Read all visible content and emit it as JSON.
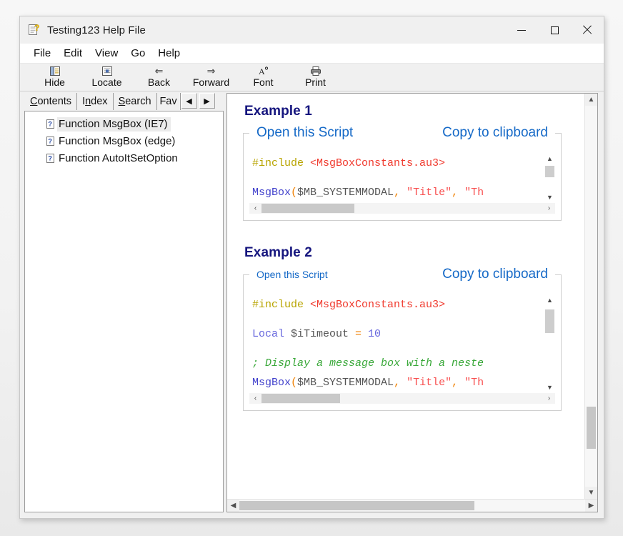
{
  "window": {
    "title": "Testing123 Help File",
    "icon": "help-document-icon",
    "controls": {
      "minimize": "minimize-icon",
      "maximize": "maximize-icon",
      "close": "close-icon"
    }
  },
  "menu": {
    "items": [
      "File",
      "Edit",
      "View",
      "Go",
      "Help"
    ]
  },
  "toolbar": {
    "buttons": [
      {
        "label": "Hide",
        "icon": "hide-pane-icon"
      },
      {
        "label": "Locate",
        "icon": "locate-topic-icon"
      },
      {
        "label": "Back",
        "icon": "back-arrow-icon"
      },
      {
        "label": "Forward",
        "icon": "forward-arrow-icon"
      },
      {
        "label": "Font",
        "icon": "font-icon"
      },
      {
        "label": "Print",
        "icon": "printer-icon"
      }
    ]
  },
  "left_pane": {
    "tabs": [
      {
        "label": "Contents",
        "accel": "C",
        "active": true
      },
      {
        "label": "Index",
        "accel": "n",
        "active": false
      },
      {
        "label": "Search",
        "accel": "S",
        "active": false
      },
      {
        "label": "Fav",
        "accel": "",
        "active": false,
        "clipped": true
      }
    ],
    "tab_nav": {
      "prev": "left-arrow-icon",
      "next": "right-arrow-icon"
    },
    "tree_items": [
      {
        "label": "Function MsgBox (IE7)",
        "icon": "help-topic-icon",
        "selected": true
      },
      {
        "label": "Function MsgBox (edge)",
        "icon": "help-topic-icon",
        "selected": false
      },
      {
        "label": "Function AutoItSetOption",
        "icon": "help-topic-icon",
        "selected": false
      }
    ]
  },
  "content": {
    "examples": [
      {
        "title": "Example 1",
        "open_link": "Open this Script",
        "copy_link": "Copy to clipboard",
        "open_link_size": "big",
        "code_lines": [
          [
            {
              "t": "#include ",
              "c": "tok-pre"
            },
            {
              "t": "<MsgBoxConstants.au3>",
              "c": "tok-inc"
            }
          ],
          [],
          [
            {
              "t": "MsgBox",
              "c": "tok-fn"
            },
            {
              "t": "(",
              "c": "tok-punct"
            },
            {
              "t": "$MB_SYSTEMMODAL",
              "c": "tok-var"
            },
            {
              "t": ", ",
              "c": "tok-punct"
            },
            {
              "t": "\"Title\"",
              "c": "tok-str"
            },
            {
              "t": ", ",
              "c": "tok-punct"
            },
            {
              "t": "\"Th",
              "c": "tok-str"
            }
          ]
        ],
        "hscroll_thumb_pct": 33,
        "vscroll_thumb_pct": 40
      },
      {
        "title": "Example 2",
        "open_link": "Open this Script",
        "copy_link": "Copy to clipboard",
        "open_link_size": "small",
        "code_lines": [
          [
            {
              "t": "#include ",
              "c": "tok-pre"
            },
            {
              "t": "<MsgBoxConstants.au3>",
              "c": "tok-inc"
            }
          ],
          [],
          [
            {
              "t": "Local ",
              "c": "tok-kw"
            },
            {
              "t": "$iTimeout ",
              "c": "tok-var"
            },
            {
              "t": "= ",
              "c": "tok-punct"
            },
            {
              "t": "10",
              "c": "tok-num"
            }
          ],
          [],
          [
            {
              "t": "; Display a message box with a neste",
              "c": "tok-cmt"
            }
          ],
          [
            {
              "t": "MsgBox",
              "c": "tok-fn"
            },
            {
              "t": "(",
              "c": "tok-punct"
            },
            {
              "t": "$MB_SYSTEMMODAL",
              "c": "tok-var"
            },
            {
              "t": ", ",
              "c": "tok-punct"
            },
            {
              "t": "\"Title\"",
              "c": "tok-str"
            },
            {
              "t": ", ",
              "c": "tok-punct"
            },
            {
              "t": "\"Th",
              "c": "tok-str"
            }
          ]
        ],
        "hscroll_thumb_pct": 28,
        "vscroll_thumb_pct": 30
      }
    ]
  },
  "scrollbars": {
    "content_vertical": {
      "up": "scroll-up-icon",
      "down": "scroll-down-icon",
      "thumb_top_pct": 79,
      "thumb_height_pct": 11
    },
    "content_horizontal": {
      "left": "scroll-left-icon",
      "right": "scroll-right-icon",
      "thumb_left_pct": 0,
      "thumb_width_pct": 68
    }
  },
  "colors": {
    "heading": "#15157e",
    "link": "#1569c7",
    "titlebar": "#f0f0f0",
    "toolbar": "#f0f0f0",
    "pane_bg": "#f0f0f0"
  }
}
